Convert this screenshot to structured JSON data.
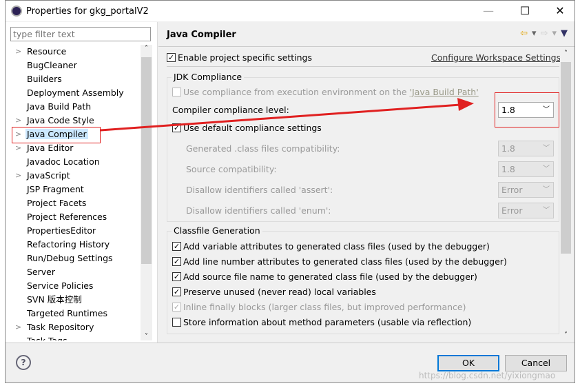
{
  "window": {
    "title": "Properties for gkg_portalV2"
  },
  "filter": {
    "placeholder": "type filter text"
  },
  "tree": [
    {
      "label": "Resource",
      "expandable": true
    },
    {
      "label": "BugCleaner"
    },
    {
      "label": "Builders"
    },
    {
      "label": "Deployment Assembly"
    },
    {
      "label": "Java Build Path"
    },
    {
      "label": "Java Code Style",
      "expandable": true
    },
    {
      "label": "Java Compiler",
      "expandable": true,
      "selected": true
    },
    {
      "label": "Java Editor",
      "expandable": true
    },
    {
      "label": "Javadoc Location"
    },
    {
      "label": "JavaScript",
      "expandable": true
    },
    {
      "label": "JSP Fragment"
    },
    {
      "label": "Project Facets"
    },
    {
      "label": "Project References"
    },
    {
      "label": "PropertiesEditor"
    },
    {
      "label": "Refactoring History"
    },
    {
      "label": "Run/Debug Settings"
    },
    {
      "label": "Server"
    },
    {
      "label": "Service Policies"
    },
    {
      "label": "SVN 版本控制"
    },
    {
      "label": "Targeted Runtimes"
    },
    {
      "label": "Task Repository",
      "expandable": true
    },
    {
      "label": "Task Tags"
    }
  ],
  "page": {
    "title": "Java Compiler",
    "enable_specific": {
      "label": "Enable project specific settings",
      "checked": true
    },
    "configure_link": "Configure Workspace Settings...",
    "jdk": {
      "group": "JDK Compliance",
      "use_exec_env": "Use compliance from execution environment on the ",
      "use_exec_env_link": "'Java Build Path'",
      "compliance_label": "Compiler compliance level:",
      "compliance_value": "1.8",
      "use_default": {
        "label": "Use default compliance settings",
        "checked": true
      },
      "fields": [
        {
          "label": "Generated .class files compatibility:",
          "value": "1.8"
        },
        {
          "label": "Source compatibility:",
          "value": "1.8"
        },
        {
          "label": "Disallow identifiers called 'assert':",
          "value": "Error"
        },
        {
          "label": "Disallow identifiers called 'enum':",
          "value": "Error"
        }
      ]
    },
    "classfile": {
      "group": "Classfile Generation",
      "options": [
        {
          "label": "Add variable attributes to generated class files (used by the debugger)",
          "checked": true
        },
        {
          "label": "Add line number attributes to generated class files (used by the debugger)",
          "checked": true
        },
        {
          "label": "Add source file name to generated class file (used by the debugger)",
          "checked": true
        },
        {
          "label": "Preserve unused (never read) local variables",
          "checked": true
        },
        {
          "label": "Inline finally blocks (larger class files, but improved performance)",
          "checked": true,
          "disabled": true
        },
        {
          "label": "Store information about method parameters (usable via reflection)",
          "checked": false
        }
      ]
    }
  },
  "buttons": {
    "ok": "OK",
    "cancel": "Cancel",
    "help": "?"
  },
  "watermark": "https://blog.csdn.net/yixiongmao",
  "annotation_color": "#e02020"
}
